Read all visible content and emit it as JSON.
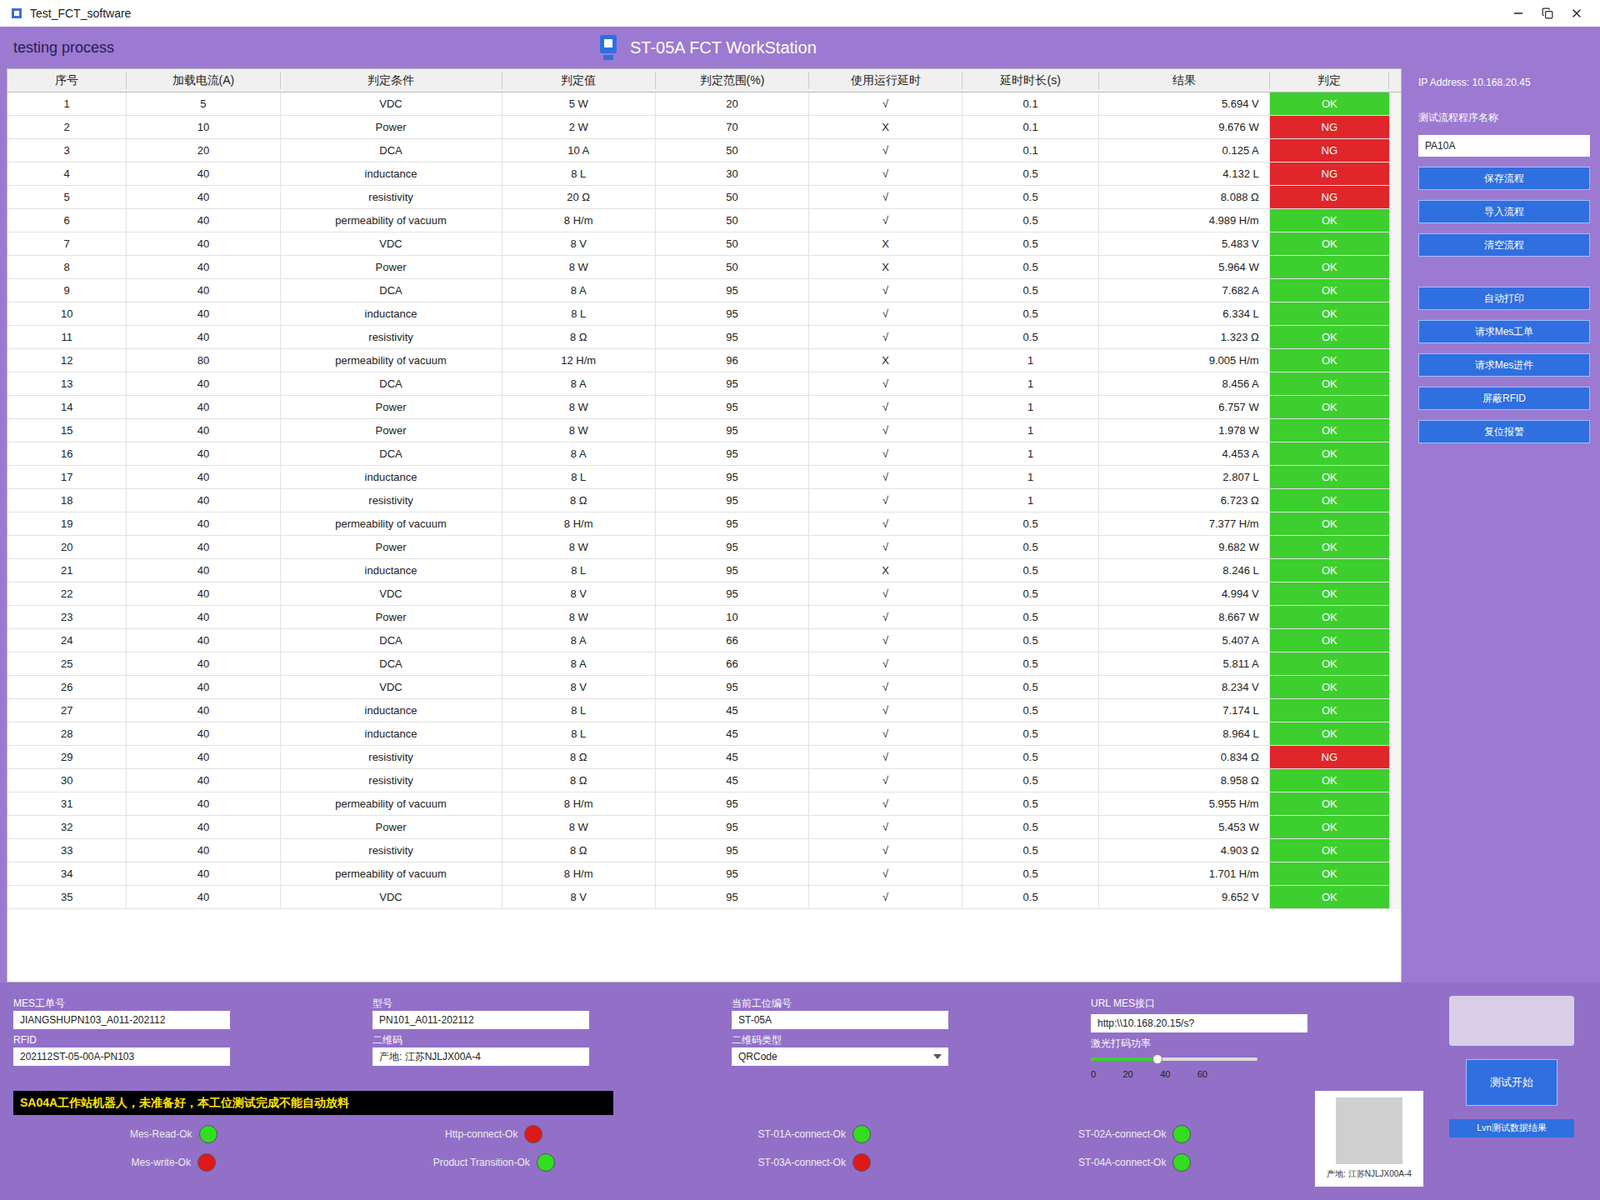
{
  "window": {
    "title": "Test_FCT_software",
    "section": "testing process",
    "heading": "ST-05A FCT WorkStation"
  },
  "table": {
    "columns": [
      "序号",
      "加载电流(A)",
      "判定条件",
      "判定值",
      "判定范围(%)",
      "使用运行延时",
      "延时时长(s)",
      "结果",
      "判定"
    ],
    "rows": [
      {
        "no": "1",
        "current": "5",
        "cond": "VDC",
        "value": "5 W",
        "range": "20",
        "delay": "√",
        "time": "0.1",
        "result": "5.694 V",
        "judge": "OK",
        "color": "#3ccf2e"
      },
      {
        "no": "2",
        "current": "10",
        "cond": "Power",
        "value": "2 W",
        "range": "70",
        "delay": "X",
        "time": "0.1",
        "result": "9.676 W",
        "judge": "NG",
        "color": "#e0262b"
      },
      {
        "no": "3",
        "current": "20",
        "cond": "DCA",
        "value": "10 A",
        "range": "50",
        "delay": "√",
        "time": "0.1",
        "result": "0.125 A",
        "judge": "NG",
        "color": "#e0262b"
      },
      {
        "no": "4",
        "current": "40",
        "cond": "inductance",
        "value": "8 L",
        "range": "30",
        "delay": "√",
        "time": "0.5",
        "result": "4.132 L",
        "judge": "NG",
        "color": "#e0262b"
      },
      {
        "no": "5",
        "current": "40",
        "cond": "resistivity",
        "value": "20 Ω",
        "range": "50",
        "delay": "√",
        "time": "0.5",
        "result": "8.088 Ω",
        "judge": "NG",
        "color": "#e0262b"
      },
      {
        "no": "6",
        "current": "40",
        "cond": "permeability of vacuum",
        "value": "8 H/m",
        "range": "50",
        "delay": "√",
        "time": "0.5",
        "result": "4.989 H/m",
        "judge": "OK",
        "color": "#3ccf2e"
      },
      {
        "no": "7",
        "current": "40",
        "cond": "VDC",
        "value": "8 V",
        "range": "50",
        "delay": "X",
        "time": "0.5",
        "result": "5.483 V",
        "judge": "OK",
        "color": "#3ccf2e"
      },
      {
        "no": "8",
        "current": "40",
        "cond": "Power",
        "value": "8 W",
        "range": "50",
        "delay": "X",
        "time": "0.5",
        "result": "5.964 W",
        "judge": "OK",
        "color": "#3ccf2e"
      },
      {
        "no": "9",
        "current": "40",
        "cond": "DCA",
        "value": "8 A",
        "range": "95",
        "delay": "√",
        "time": "0.5",
        "result": "7.682 A",
        "judge": "OK",
        "color": "#3ccf2e"
      },
      {
        "no": "10",
        "current": "40",
        "cond": "inductance",
        "value": "8 L",
        "range": "95",
        "delay": "√",
        "time": "0.5",
        "result": "6.334 L",
        "judge": "OK",
        "color": "#3ccf2e"
      },
      {
        "no": "11",
        "current": "40",
        "cond": "resistivity",
        "value": "8 Ω",
        "range": "95",
        "delay": "√",
        "time": "0.5",
        "result": "1.323 Ω",
        "judge": "OK",
        "color": "#3ccf2e"
      },
      {
        "no": "12",
        "current": "80",
        "cond": "permeability of vacuum",
        "value": "12 H/m",
        "range": "96",
        "delay": "X",
        "time": "1",
        "result": "9.005 H/m",
        "judge": "OK",
        "color": "#3ccf2e"
      },
      {
        "no": "13",
        "current": "40",
        "cond": "DCA",
        "value": "8 A",
        "range": "95",
        "delay": "√",
        "time": "1",
        "result": "8.456 A",
        "judge": "OK",
        "color": "#3ccf2e"
      },
      {
        "no": "14",
        "current": "40",
        "cond": "Power",
        "value": "8 W",
        "range": "95",
        "delay": "√",
        "time": "1",
        "result": "6.757 W",
        "judge": "OK",
        "color": "#3ccf2e"
      },
      {
        "no": "15",
        "current": "40",
        "cond": "Power",
        "value": "8 W",
        "range": "95",
        "delay": "√",
        "time": "1",
        "result": "1.978 W",
        "judge": "OK",
        "color": "#3ccf2e"
      },
      {
        "no": "16",
        "current": "40",
        "cond": "DCA",
        "value": "8 A",
        "range": "95",
        "delay": "√",
        "time": "1",
        "result": "4.453 A",
        "judge": "OK",
        "color": "#3ccf2e"
      },
      {
        "no": "17",
        "current": "40",
        "cond": "inductance",
        "value": "8 L",
        "range": "95",
        "delay": "√",
        "time": "1",
        "result": "2.807 L",
        "judge": "OK",
        "color": "#3ccf2e"
      },
      {
        "no": "18",
        "current": "40",
        "cond": "resistivity",
        "value": "8 Ω",
        "range": "95",
        "delay": "√",
        "time": "1",
        "result": "6.723 Ω",
        "judge": "OK",
        "color": "#3ccf2e"
      },
      {
        "no": "19",
        "current": "40",
        "cond": "permeability of vacuum",
        "value": "8 H/m",
        "range": "95",
        "delay": "√",
        "time": "0.5",
        "result": "7.377 H/m",
        "judge": "OK",
        "color": "#3ccf2e"
      },
      {
        "no": "20",
        "current": "40",
        "cond": "Power",
        "value": "8 W",
        "range": "95",
        "delay": "√",
        "time": "0.5",
        "result": "9.682 W",
        "judge": "OK",
        "color": "#3ccf2e"
      },
      {
        "no": "21",
        "current": "40",
        "cond": "inductance",
        "value": "8 L",
        "range": "95",
        "delay": "X",
        "time": "0.5",
        "result": "8.246 L",
        "judge": "OK",
        "color": "#3ccf2e"
      },
      {
        "no": "22",
        "current": "40",
        "cond": "VDC",
        "value": "8 V",
        "range": "95",
        "delay": "√",
        "time": "0.5",
        "result": "4.994 V",
        "judge": "OK",
        "color": "#3ccf2e"
      },
      {
        "no": "23",
        "current": "40",
        "cond": "Power",
        "value": "8 W",
        "range": "10",
        "delay": "√",
        "time": "0.5",
        "result": "8.667 W",
        "judge": "OK",
        "color": "#3ccf2e"
      },
      {
        "no": "24",
        "current": "40",
        "cond": "DCA",
        "value": "8 A",
        "range": "66",
        "delay": "√",
        "time": "0.5",
        "result": "5.407 A",
        "judge": "OK",
        "color": "#3ccf2e"
      },
      {
        "no": "25",
        "current": "40",
        "cond": "DCA",
        "value": "8 A",
        "range": "66",
        "delay": "√",
        "time": "0.5",
        "result": "5.811 A",
        "judge": "OK",
        "color": "#3ccf2e"
      },
      {
        "no": "26",
        "current": "40",
        "cond": "VDC",
        "value": "8 V",
        "range": "95",
        "delay": "√",
        "time": "0.5",
        "result": "8.234 V",
        "judge": "OK",
        "color": "#3ccf2e"
      },
      {
        "no": "27",
        "current": "40",
        "cond": "inductance",
        "value": "8 L",
        "range": "45",
        "delay": "√",
        "time": "0.5",
        "result": "7.174 L",
        "judge": "OK",
        "color": "#3ccf2e"
      },
      {
        "no": "28",
        "current": "40",
        "cond": "inductance",
        "value": "8 L",
        "range": "45",
        "delay": "√",
        "time": "0.5",
        "result": "8.964 L",
        "judge": "OK",
        "color": "#3ccf2e"
      },
      {
        "no": "29",
        "current": "40",
        "cond": "resistivity",
        "value": "8 Ω",
        "range": "45",
        "delay": "√",
        "time": "0.5",
        "result": "0.834 Ω",
        "judge": "NG",
        "color": "#e0262b"
      },
      {
        "no": "30",
        "current": "40",
        "cond": "resistivity",
        "value": "8 Ω",
        "range": "45",
        "delay": "√",
        "time": "0.5",
        "result": "8.958 Ω",
        "judge": "OK",
        "color": "#3ccf2e"
      },
      {
        "no": "31",
        "current": "40",
        "cond": "permeability of vacuum",
        "value": "8 H/m",
        "range": "95",
        "delay": "√",
        "time": "0.5",
        "result": "5.955 H/m",
        "judge": "OK",
        "color": "#3ccf2e"
      },
      {
        "no": "32",
        "current": "40",
        "cond": "Power",
        "value": "8 W",
        "range": "95",
        "delay": "√",
        "time": "0.5",
        "result": "5.453 W",
        "judge": "OK",
        "color": "#3ccf2e"
      },
      {
        "no": "33",
        "current": "40",
        "cond": "resistivity",
        "value": "8 Ω",
        "range": "95",
        "delay": "√",
        "time": "0.5",
        "result": "4.903 Ω",
        "judge": "OK",
        "color": "#3ccf2e"
      },
      {
        "no": "34",
        "current": "40",
        "cond": "permeability of vacuum",
        "value": "8 H/m",
        "range": "95",
        "delay": "√",
        "time": "0.5",
        "result": "1.701 H/m",
        "judge": "OK",
        "color": "#3ccf2e"
      },
      {
        "no": "35",
        "current": "40",
        "cond": "VDC",
        "value": "8 V",
        "range": "95",
        "delay": "√",
        "time": "0.5",
        "result": "9.652 V",
        "judge": "OK",
        "color": "#3ccf2e"
      }
    ]
  },
  "sidebar": {
    "ip": "IP Address: 10.168.20.45",
    "program_label": "测试流程程序名称",
    "program_value": "PA10A",
    "buttons": [
      "保存流程",
      "导入流程",
      "清空流程",
      "自动打印",
      "请求Mes工单",
      "请求Mes进件",
      "屏蔽RFID",
      "复位报警"
    ]
  },
  "fields": [
    {
      "label": "MES工单号",
      "value": "JIANGSHUPN103_A011-202112",
      "kind": "input"
    },
    {
      "label": "RFID",
      "value": "202112ST-05-00A-PN103",
      "kind": "input"
    },
    {
      "label": "型号",
      "value": "PN101_A011-202112",
      "kind": "input"
    },
    {
      "label": "二维码",
      "value": "产地: 江苏NJLJX00A-4",
      "kind": "input"
    },
    {
      "label": "当前工位编号",
      "value": "ST-05A",
      "kind": "input"
    },
    {
      "label": "二维码类型",
      "value": "QRCode",
      "kind": "select"
    },
    {
      "label": "URL MES接口",
      "value": "http:\\\\10.168.20.15/s?",
      "kind": "input"
    }
  ],
  "laser": {
    "label": "激光打码功率",
    "level": 0.4,
    "ticks": [
      "0",
      "20",
      "40",
      "60"
    ]
  },
  "qr": {
    "caption": "产地: 江苏NJLJX00A-4"
  },
  "warning": "SA04A工作站机器人，未准备好，本工位测试完成不能自动放料",
  "status": [
    {
      "label": "Mes-Read-Ok",
      "color": "#33dd22"
    },
    {
      "label": "Http-connect-Ok",
      "color": "#e01818"
    },
    {
      "label": "ST-01A-connect-Ok",
      "color": "#33dd22"
    },
    {
      "label": "ST-02A-connect-Ok",
      "color": "#33dd22"
    },
    {
      "label": "Mes-write-Ok",
      "color": "#e01818"
    },
    {
      "label": "Product Transition-Ok",
      "color": "#33dd22"
    },
    {
      "label": "ST-03A-connect-Ok",
      "color": "#e01818"
    },
    {
      "label": "ST-04A-connect-Ok",
      "color": "#33dd22"
    }
  ],
  "actions": {
    "start": "测试开始",
    "result": "Lvn测试数据结果"
  }
}
